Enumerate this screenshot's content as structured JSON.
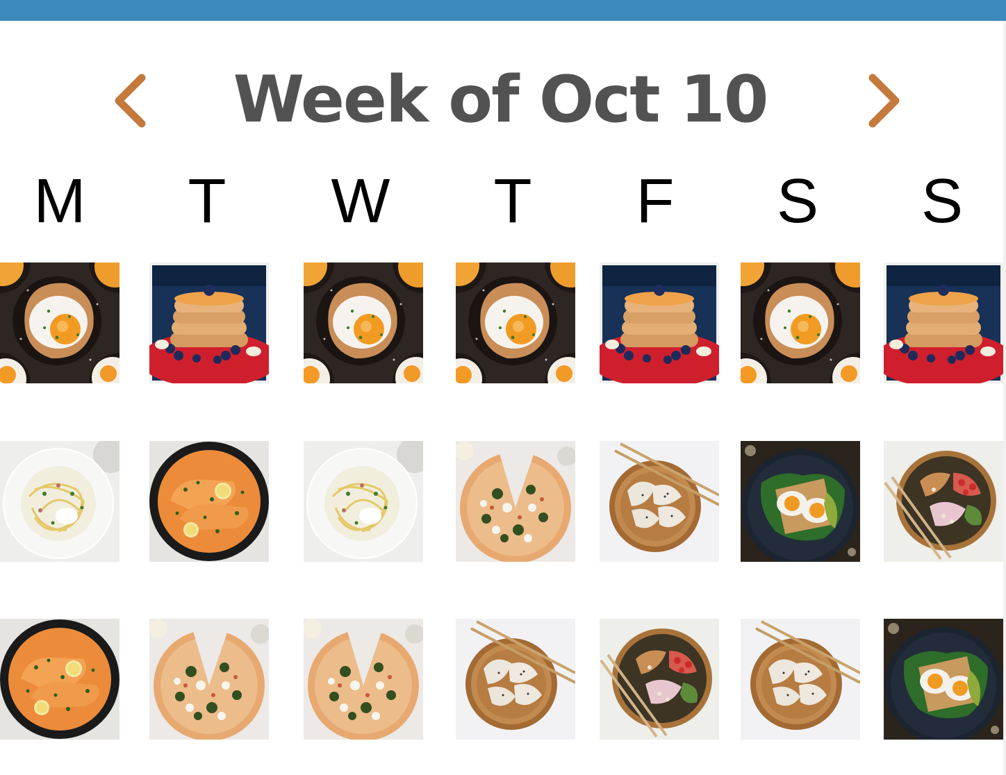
{
  "header": {
    "title": "Week of Oct 10",
    "prev_icon": "chevron-left-icon",
    "next_icon": "chevron-right-icon",
    "bar_color": "#3b8abb",
    "accent_color": "#c47a3c"
  },
  "days": [
    "M",
    "T",
    "W",
    "T",
    "F",
    "S",
    "S"
  ],
  "meals": [
    [
      "eggs",
      "pancakes",
      "eggs",
      "eggs",
      "pancakes",
      "eggs",
      "pancakes"
    ],
    [
      "pasta",
      "salmon",
      "pasta",
      "pizza",
      "dumplings",
      "egg-toast",
      "bowl"
    ],
    [
      "salmon",
      "pizza",
      "pizza",
      "dumplings",
      "bowl",
      "dumplings",
      "egg-toast"
    ]
  ]
}
